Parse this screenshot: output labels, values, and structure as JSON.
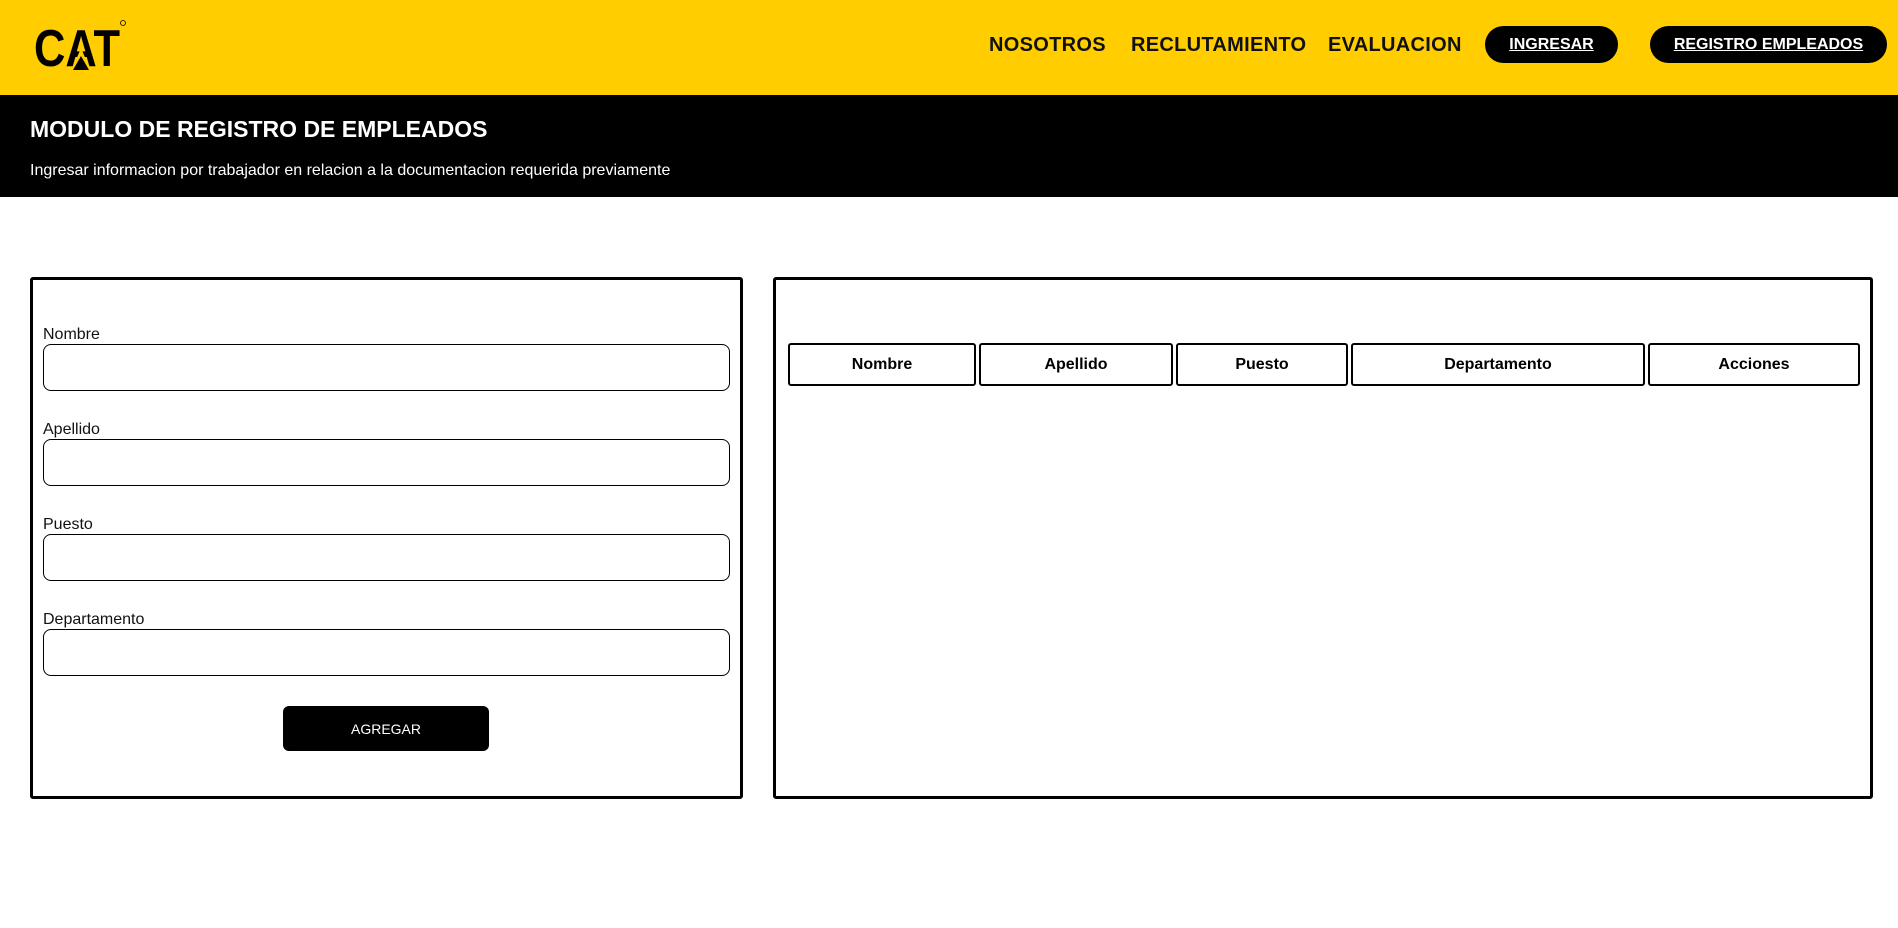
{
  "header": {
    "logo_text": "CAT",
    "nav": {
      "nosotros": "NOSOTROS",
      "reclutamiento": "RECLUTAMIENTO",
      "evaluacion": "EVALUACION",
      "ingresar": "INGRESAR",
      "registro_empleados": "REGISTRO EMPLEADOS"
    }
  },
  "banner": {
    "title": "MODULO DE REGISTRO DE EMPLEADOS",
    "subtitle": "Ingresar informacion por trabajador en relacion a la documentacion requerida previamente"
  },
  "form": {
    "fields": [
      {
        "label": "Nombre",
        "value": ""
      },
      {
        "label": "Apellido",
        "value": ""
      },
      {
        "label": "Puesto",
        "value": ""
      },
      {
        "label": "Departamento",
        "value": ""
      }
    ],
    "submit_label": "AGREGAR"
  },
  "table": {
    "columns": [
      "Nombre",
      "Apellido",
      "Puesto",
      "Departamento",
      "Acciones"
    ],
    "rows": []
  },
  "colors": {
    "brand_yellow": "#ffcd00",
    "black": "#000000",
    "white": "#ffffff"
  }
}
